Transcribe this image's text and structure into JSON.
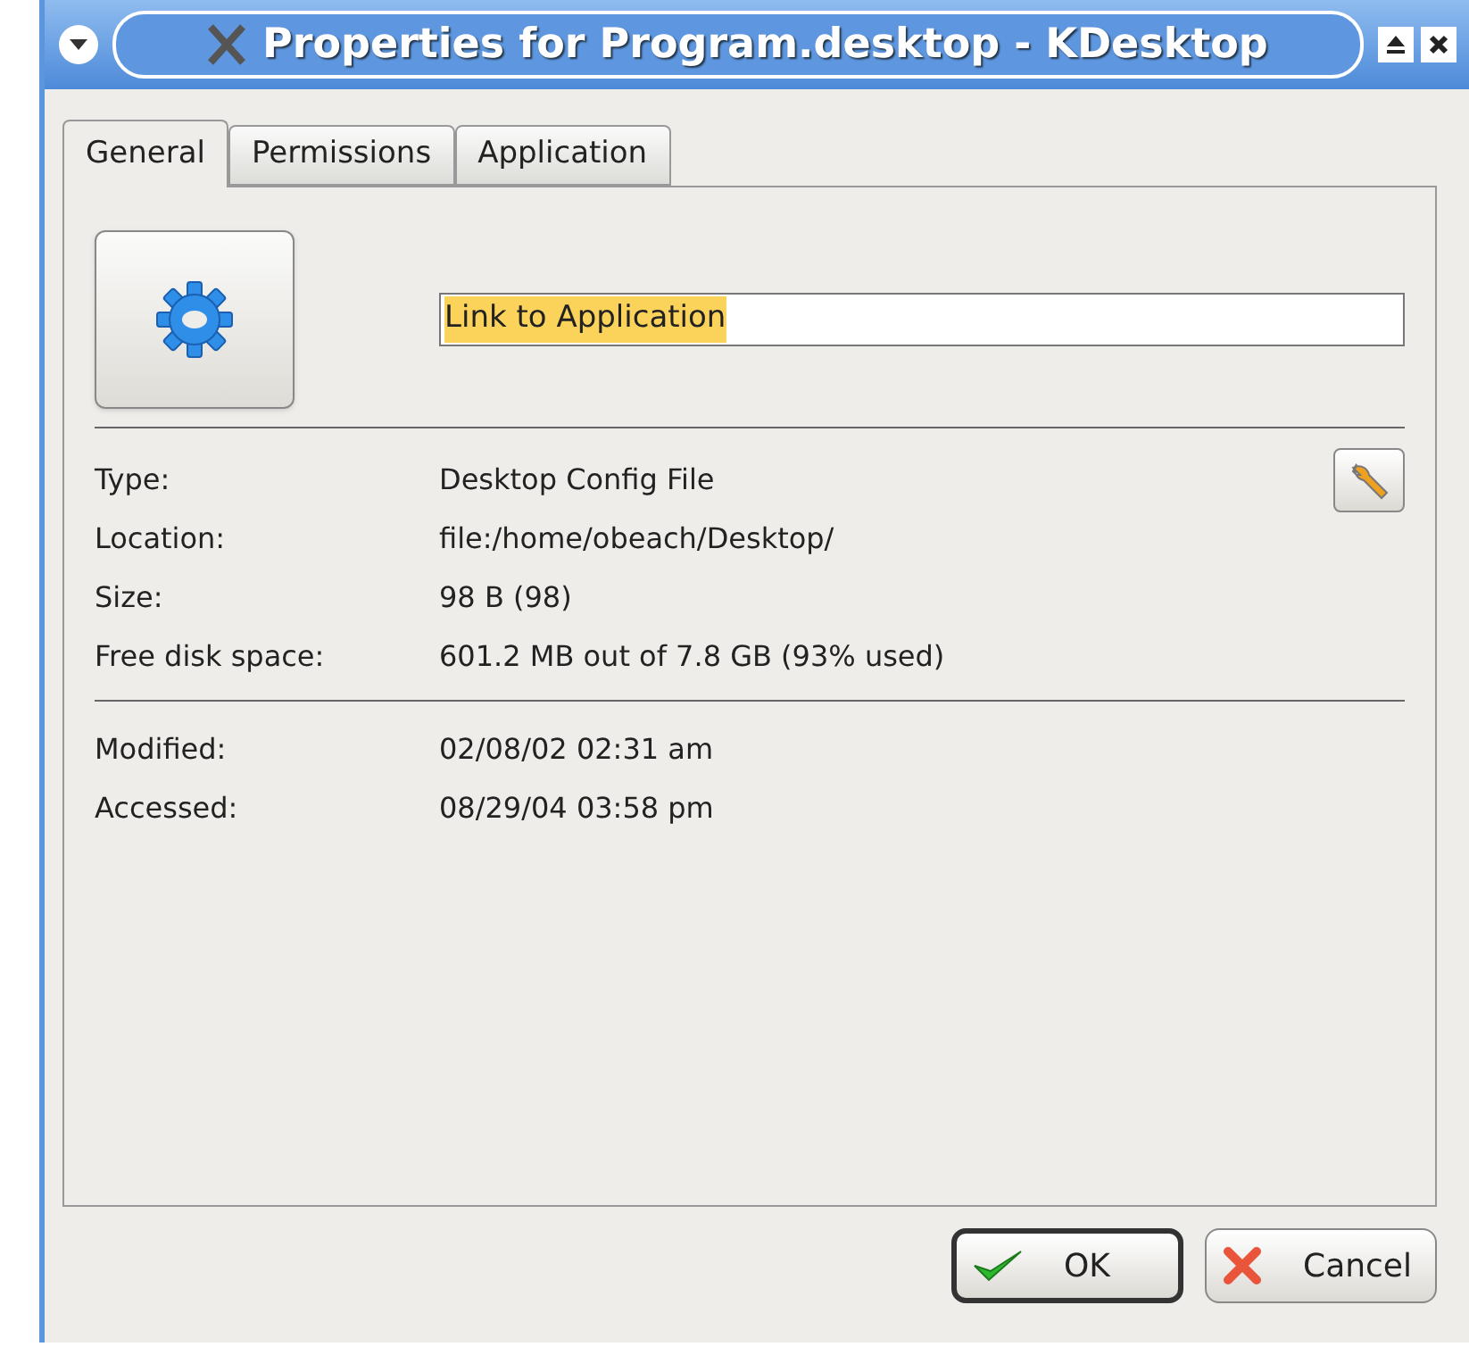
{
  "window": {
    "title": "Properties for Program.desktop - KDesktop"
  },
  "tabs": [
    {
      "label": "General",
      "selected": true
    },
    {
      "label": "Permissions",
      "selected": false
    },
    {
      "label": "Application",
      "selected": false
    }
  ],
  "name_field": {
    "value": "Link to Application",
    "selected": true
  },
  "info_groups": [
    [
      {
        "label": "Type:",
        "value": "Desktop Config File",
        "kind": "edit"
      },
      {
        "label": "Location:",
        "value": "file:/home/obeach/Desktop/",
        "kind": "plain"
      },
      {
        "label": "Size:",
        "value": "98 B (98)",
        "kind": "plain"
      },
      {
        "label": "Free disk space:",
        "value": "601.2 MB out of 7.8 GB (93% used)",
        "kind": "plain"
      }
    ],
    [
      {
        "label": "Modified:",
        "value": "02/08/02 02:31 am",
        "kind": "plain"
      },
      {
        "label": "Accessed:",
        "value": "08/29/04 03:58 pm",
        "kind": "plain"
      }
    ]
  ],
  "buttons": [
    {
      "label": "OK",
      "kind": "ok",
      "selected": true
    },
    {
      "label": "Cancel",
      "kind": "cancel",
      "selected": false
    }
  ]
}
